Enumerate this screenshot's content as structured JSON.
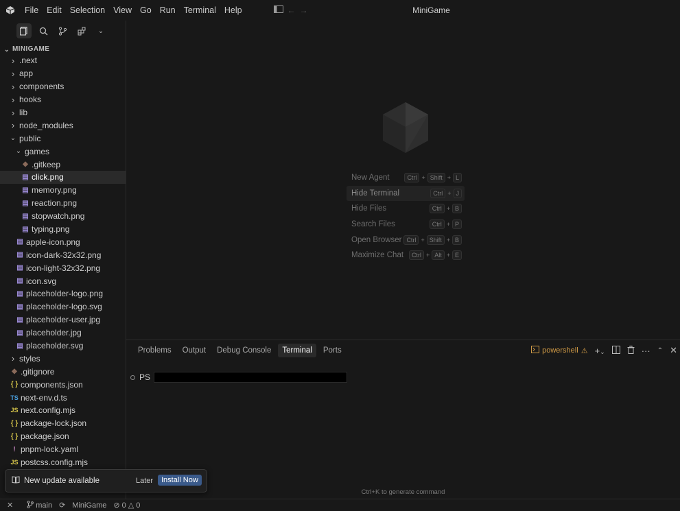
{
  "menu": [
    "File",
    "Edit",
    "Selection",
    "View",
    "Go",
    "Run",
    "Terminal",
    "Help"
  ],
  "window_title": "MiniGame",
  "explorer": {
    "header": "MINIGAME",
    "tree": [
      {
        "name": ".next",
        "type": "folder",
        "depth": 0,
        "expanded": false
      },
      {
        "name": "app",
        "type": "folder",
        "depth": 0,
        "expanded": false
      },
      {
        "name": "components",
        "type": "folder",
        "depth": 0,
        "expanded": false
      },
      {
        "name": "hooks",
        "type": "folder",
        "depth": 0,
        "expanded": false
      },
      {
        "name": "lib",
        "type": "folder",
        "depth": 0,
        "expanded": false
      },
      {
        "name": "node_modules",
        "type": "folder",
        "depth": 0,
        "expanded": false
      },
      {
        "name": "public",
        "type": "folder",
        "depth": 0,
        "expanded": true
      },
      {
        "name": "games",
        "type": "folder",
        "depth": 1,
        "expanded": true
      },
      {
        "name": ".gitkeep",
        "type": "git",
        "depth": 2
      },
      {
        "name": "click.png",
        "type": "img",
        "depth": 2,
        "selected": true
      },
      {
        "name": "memory.png",
        "type": "img",
        "depth": 2
      },
      {
        "name": "reaction.png",
        "type": "img",
        "depth": 2
      },
      {
        "name": "stopwatch.png",
        "type": "img",
        "depth": 2
      },
      {
        "name": "typing.png",
        "type": "img",
        "depth": 2
      },
      {
        "name": "apple-icon.png",
        "type": "img",
        "depth": 1
      },
      {
        "name": "icon-dark-32x32.png",
        "type": "img",
        "depth": 1
      },
      {
        "name": "icon-light-32x32.png",
        "type": "img",
        "depth": 1
      },
      {
        "name": "icon.svg",
        "type": "img",
        "depth": 1
      },
      {
        "name": "placeholder-logo.png",
        "type": "img",
        "depth": 1
      },
      {
        "name": "placeholder-logo.svg",
        "type": "img",
        "depth": 1
      },
      {
        "name": "placeholder-user.jpg",
        "type": "img",
        "depth": 1
      },
      {
        "name": "placeholder.jpg",
        "type": "img",
        "depth": 1
      },
      {
        "name": "placeholder.svg",
        "type": "img",
        "depth": 1
      },
      {
        "name": "styles",
        "type": "folder",
        "depth": 0,
        "expanded": false
      },
      {
        "name": ".gitignore",
        "type": "git",
        "depth": 0
      },
      {
        "name": "components.json",
        "type": "json",
        "depth": 0
      },
      {
        "name": "next-env.d.ts",
        "type": "ts",
        "depth": 0
      },
      {
        "name": "next.config.mjs",
        "type": "js",
        "depth": 0
      },
      {
        "name": "package-lock.json",
        "type": "json",
        "depth": 0
      },
      {
        "name": "package.json",
        "type": "json",
        "depth": 0
      },
      {
        "name": "pnpm-lock.yaml",
        "type": "yaml",
        "depth": 0
      },
      {
        "name": "postcss.config.mjs",
        "type": "js",
        "depth": 0
      }
    ]
  },
  "shortcuts": [
    {
      "label": "New Agent",
      "keys": [
        "Ctrl",
        "Shift",
        "L"
      ]
    },
    {
      "label": "Hide Terminal",
      "keys": [
        "Ctrl",
        "J"
      ],
      "highlighted": true
    },
    {
      "label": "Hide Files",
      "keys": [
        "Ctrl",
        "B"
      ]
    },
    {
      "label": "Search Files",
      "keys": [
        "Ctrl",
        "P"
      ]
    },
    {
      "label": "Open Browser",
      "keys": [
        "Ctrl",
        "Shift",
        "B"
      ]
    },
    {
      "label": "Maximize Chat",
      "keys": [
        "Ctrl",
        "Alt",
        "E"
      ]
    }
  ],
  "panel": {
    "tabs": [
      "Problems",
      "Output",
      "Debug Console",
      "Terminal",
      "Ports"
    ],
    "active_tab": "Terminal",
    "shell": "powershell",
    "prompt": "PS",
    "hint": "Ctrl+K to generate command"
  },
  "toast": {
    "message": "New update available",
    "later": "Later",
    "install": "Install Now"
  },
  "status": {
    "branch": "main",
    "project": "MiniGame",
    "errors": "0",
    "warnings": "0"
  },
  "colors": {
    "background": "#181818",
    "accent": "#3a5a8a",
    "warning": "#d09a46"
  }
}
